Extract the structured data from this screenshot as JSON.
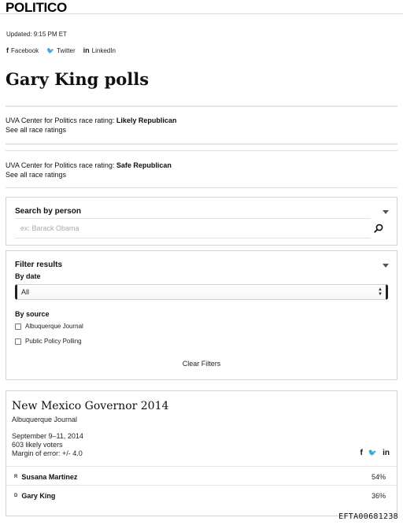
{
  "brand": {
    "logo": "POLITICO"
  },
  "meta": {
    "updated": "Updated: 9:15 PM ET"
  },
  "share": [
    {
      "icon": "facebook-icon",
      "glyph": "f",
      "label": "Facebook"
    },
    {
      "icon": "twitter-icon",
      "glyph": "🐦",
      "label": "Twitter"
    },
    {
      "icon": "linkedin-icon",
      "glyph": "in",
      "label": "LinkedIn"
    }
  ],
  "page": {
    "title": "Gary King polls"
  },
  "ratings": [
    {
      "prefix": "UVA Center for Politics race rating: ",
      "value": "Likely Republican",
      "link": "See all race ratings"
    },
    {
      "prefix": "UVA Center for Politics race rating: ",
      "value": "Safe Republican",
      "link": "See all race ratings"
    }
  ],
  "search": {
    "title": "Search by person",
    "placeholder": "ex: Barack Obama"
  },
  "filter": {
    "title": "Filter results",
    "by_date_label": "By date",
    "date_value": "All",
    "by_source_label": "By source",
    "sources": [
      "Albuquerque Journal",
      "Public Policy Polling"
    ],
    "clear_label": "Clear Filters"
  },
  "poll": {
    "title": "New Mexico Governor 2014",
    "source": "Albuquerque Journal",
    "dates": "September 9–11, 2014",
    "sample": "603 likely voters",
    "margin": "Margin of error: +/- 4.0",
    "share_icons": [
      "f",
      "🐦",
      "in"
    ],
    "candidates": [
      {
        "party": "R",
        "name": "Susana Martinez",
        "pct": "54%"
      },
      {
        "party": "D",
        "name": "Gary King",
        "pct": "36%"
      }
    ]
  },
  "footer": {
    "doc_id": "EFTA00681238"
  }
}
